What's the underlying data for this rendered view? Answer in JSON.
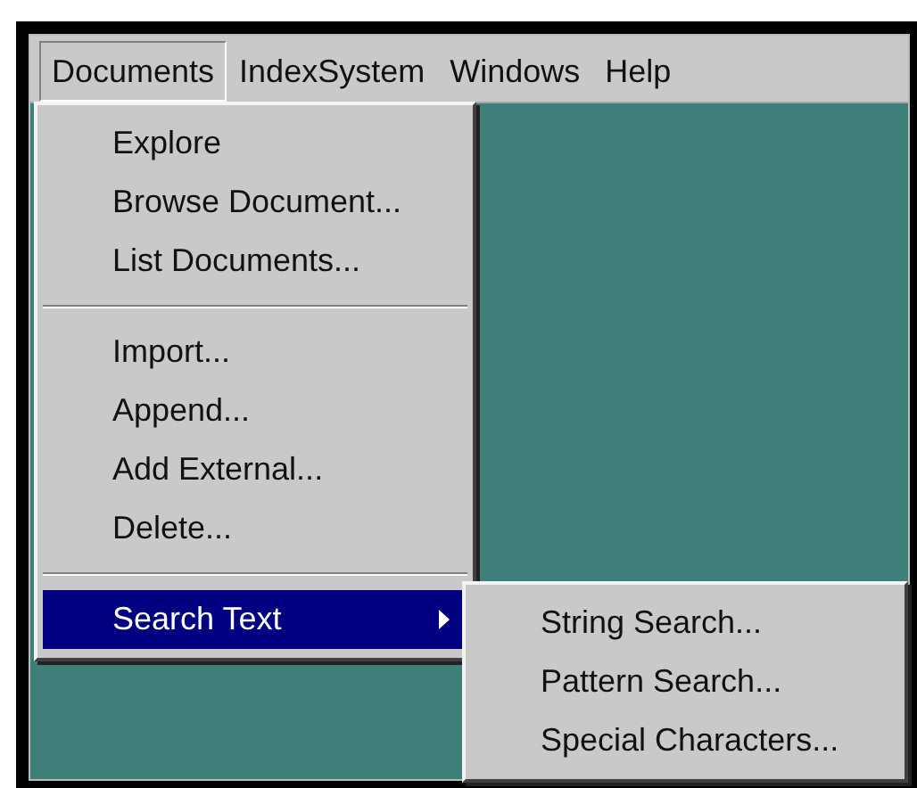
{
  "menubar": [
    {
      "label": "Documents",
      "selected": true
    },
    {
      "label": "IndexSystem",
      "selected": false
    },
    {
      "label": "Windows",
      "selected": false
    },
    {
      "label": "Help",
      "selected": false
    }
  ],
  "menu": {
    "items": [
      {
        "kind": "item",
        "label": "Explore",
        "selected": false
      },
      {
        "kind": "item",
        "label": "Browse Document...",
        "selected": false
      },
      {
        "kind": "item",
        "label": "List Documents...",
        "selected": false
      },
      {
        "kind": "separator"
      },
      {
        "kind": "item",
        "label": "Import...",
        "selected": false
      },
      {
        "kind": "item",
        "label": "Append...",
        "selected": false
      },
      {
        "kind": "item",
        "label": "Add External...",
        "selected": false
      },
      {
        "kind": "item",
        "label": "Delete...",
        "selected": false
      },
      {
        "kind": "separator"
      },
      {
        "kind": "submenu",
        "label": "Search Text",
        "selected": true
      }
    ]
  },
  "submenu": {
    "items": [
      {
        "kind": "item",
        "label": "String Search...",
        "selected": false
      },
      {
        "kind": "item",
        "label": "Pattern Search...",
        "selected": false
      },
      {
        "kind": "item",
        "label": "Special Characters...",
        "selected": false
      }
    ]
  }
}
